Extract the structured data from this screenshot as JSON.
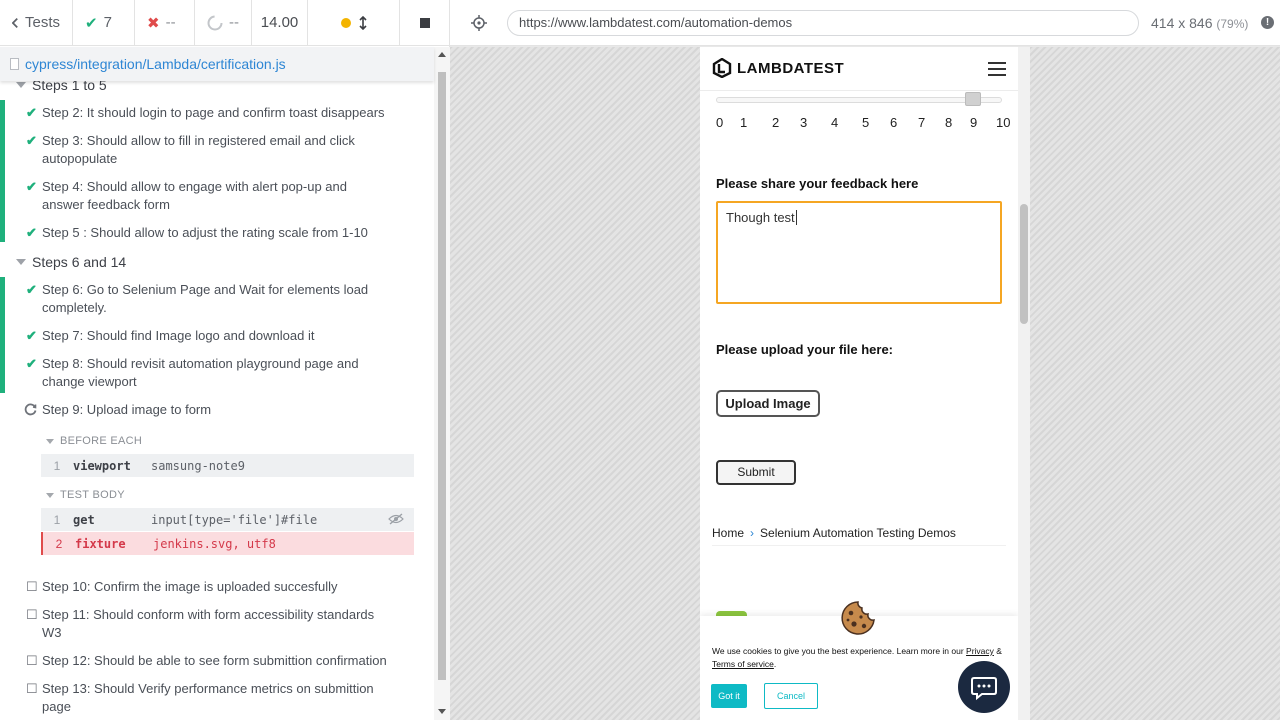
{
  "runner": {
    "tests_label": "Tests",
    "passed_count": "7",
    "failed_count": "--",
    "pending_count": "--",
    "duration": "14.00",
    "spec_file": "cypress/integration/Lambda/certification.js"
  },
  "reporter": {
    "group1": "Steps 1 to 5",
    "group2": "Steps 6 and 14",
    "steps": [
      {
        "label": "Step 2: It should login to page and confirm toast disappears",
        "state": "passed"
      },
      {
        "label": "Step 3: Should allow to fill in registered email and click autopopulate",
        "state": "passed"
      },
      {
        "label": "Step 4: Should allow to engage with alert pop-up and answer feedback form",
        "state": "passed"
      },
      {
        "label": "Step 5 : Should allow to adjust the rating scale from 1-10",
        "state": "passed"
      },
      {
        "label": "Step 6: Go to Selenium Page and Wait for elements load completely.",
        "state": "passed"
      },
      {
        "label": "Step 7: Should find Image logo and download it",
        "state": "passed"
      },
      {
        "label": "Step 8: Should revisit automation playground page and change viewport",
        "state": "passed"
      },
      {
        "label": "Step 9: Upload image to form",
        "state": "running"
      },
      {
        "label": "Step 10: Confirm the image is uploaded succesfully",
        "state": "pending"
      },
      {
        "label": "Step 11: Should conform with form accessibility standards W3",
        "state": "pending"
      },
      {
        "label": "Step 12: Should be able to see form submittion confirmation",
        "state": "pending"
      },
      {
        "label": "Step 13: Should Verify performance metrics on submittion page",
        "state": "pending"
      }
    ],
    "before_each_label": "BEFORE EACH",
    "test_body_label": "TEST BODY",
    "before_each_cmds": [
      {
        "num": "1",
        "name": "viewport",
        "arg": "samsung-note9"
      }
    ],
    "test_body_cmds": [
      {
        "num": "1",
        "name": "get",
        "arg": "input[type='file']#file"
      },
      {
        "num": "2",
        "name": "fixture",
        "arg": "jenkins.svg, utf8"
      }
    ]
  },
  "aut": {
    "url": "https://www.lambdatest.com/automation-demos",
    "viewport": "414 x 846",
    "zoom": "(79%)",
    "info_icon": "info-icon"
  },
  "page": {
    "brand": "LAMBDATEST",
    "rating_ticks": [
      "0",
      "1",
      "2",
      "3",
      "4",
      "5",
      "6",
      "7",
      "8",
      "9",
      "10"
    ],
    "rating_value": 9,
    "feedback_label": "Please share your feedback here",
    "feedback_value": "Though test",
    "upload_label": "Please upload your file here:",
    "upload_button": "Upload Image",
    "submit_button": "Submit",
    "breadcrumb_home": "Home",
    "breadcrumb_current": "Selenium Automation Testing Demos",
    "cookie_text_1": "We use cookies to give you the best experience. Learn more in our ",
    "cookie_privacy": "Privacy",
    "cookie_and": " & ",
    "cookie_terms": "Terms of service",
    "cookie_end": ".",
    "cookie_accept": "Got it",
    "cookie_cancel": "Cancel"
  },
  "colors": {
    "pass": "#1fb07c",
    "fail": "#e04b4b",
    "link": "#2e86d4",
    "focus_orange": "#f5a623",
    "cookie_teal": "#0ebac5",
    "chat_navy": "#1b2940"
  }
}
